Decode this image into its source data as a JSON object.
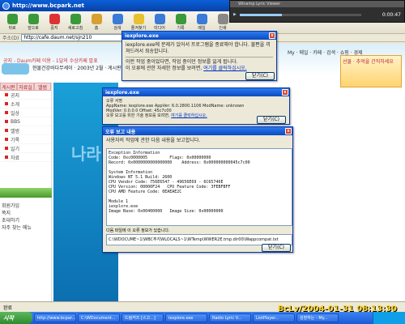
{
  "browser": {
    "title": "http://www.bcpark.net",
    "address_label": "주소(D)",
    "address": "http://cafe.daum.net/sjn210",
    "toolbar": [
      {
        "label": "뒤로",
        "icon": "back-icon",
        "color": "#3a9a3a"
      },
      {
        "label": "앞으로",
        "icon": "forward-icon",
        "color": "#3a9a3a"
      },
      {
        "label": "중지",
        "icon": "stop-icon",
        "color": "#d33"
      },
      {
        "label": "새로고침",
        "icon": "refresh-icon",
        "color": "#3a9a3a"
      },
      {
        "label": "홈",
        "icon": "home-icon",
        "color": "#d8a030"
      },
      {
        "label": "검색",
        "icon": "search-icon",
        "color": "#3a7ad8"
      },
      {
        "label": "즐겨찾기",
        "icon": "favorites-icon",
        "color": "#e8c030"
      },
      {
        "label": "미디어",
        "icon": "media-icon",
        "color": "#3a7ad8"
      },
      {
        "label": "기록",
        "icon": "history-icon",
        "color": "#3a9a3a"
      },
      {
        "label": "메일",
        "icon": "mail-icon",
        "color": "#3a7ad8"
      },
      {
        "label": "인쇄",
        "icon": "print-icon",
        "color": "#888"
      }
    ],
    "status": "완료"
  },
  "webpage": {
    "crumb": "공지 - Daum카페 이용 - 1달의 수상카페 발표",
    "cafe_title": "현물건강바다무세이 · 2003년 2월 · 게시판",
    "nav_links": "My · 메일 · 카페 · 검색 · 쇼핑 · 경제",
    "ad_text": "선물 · 추억을 간직하세요",
    "tabs": [
      "게시판",
      "자료실",
      "앨범"
    ],
    "menu_items": [
      "공지",
      "소개",
      "일상",
      "BBS",
      "앨범",
      "기록",
      "일기",
      "자료"
    ],
    "side_tools": [
      "회원가입",
      "쪽지",
      "초대하기",
      "자주 찾는 메뉴"
    ],
    "nara_text": "나라"
  },
  "dialog_small": {
    "title": "iexplore.exe",
    "line1": "iexplore.exe에 문제가 있어서 프로그램을 종료해야 합니다. 불편을 끼쳐드려서 죄송합니다.",
    "line2": "이런 작업 중이었다면, 작업 중이던 정보를 잃게 됩니다.",
    "line3": "이 오류에 관한 자세한 정보를 보려면,",
    "link": "여기를 클릭하십시오.",
    "close_label": "닫기(C)"
  },
  "dialog_mid": {
    "title": "iexplore.exe",
    "heading": "오류 서명",
    "line1": "AppName: iexplore.exe    AppVer: 6.0.2800.1106    ModName: unknown",
    "line2": "ModVer: 0.0.0.0    Offset: 45c7c00",
    "line3": "오류 보고를 위한 기술 정보를 보려면,",
    "link": "여기를 클릭하십시오.",
    "close_label": "닫기(C)"
  },
  "dialog_report": {
    "title": "오류 보고 내용",
    "intro": "사용자의 작업에 관한 다음 내용을 보고합니다.",
    "report_lines": "Exception Information\nCode: 0xc0000005         Flags: 0x00000000\nRecord: 0x0000000000000000    Address: 0x000000000045c7c00\n\nSystem Information\nWindows NT 5.1 Build: 2600\nCPU Vendor Code: 756E6547 - 49656E69 - 6C65746E\nCPU Version: 00000F24   CPU Feature Code: 3FEBFBFF\nCPU AMD Feature Code: 0EAEAE2C\n\nModule 1\niexplore.exe\nImage Base: 0x00400000   Image Size: 0x00000000",
    "path_label": "다음 파일에 이 오류 정보가 있습니다.",
    "path": "C:\\WDOCUME~1\\WBC주지WLOCALS~1\\WTemp\\WWER2E.tmp.dir00\\Wappcompat.txt",
    "close_label": "닫기(C)"
  },
  "lyric": {
    "title": "Winamp Lyric Viewer",
    "time": "0:00:47",
    "progress": 0.35
  },
  "taskbar": {
    "start_label": "시작",
    "tasks": [
      "http://www.bcpar...",
      "C:\\WDocument...",
      "드림커즈 [스고...]",
      "iexplore.exe",
      "Radio Lyric V...",
      "ListPlayer...",
      "성장하는 - My..."
    ]
  },
  "stamp": "BcLv/2004-01-31 08:13:30"
}
